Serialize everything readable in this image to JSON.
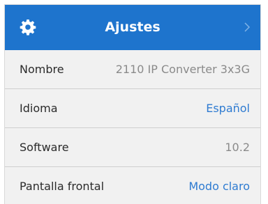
{
  "header": {
    "title": "Ajustes",
    "icon": "gear-icon",
    "chevron_icon": "chevron-right-icon",
    "background": "#1e74cd"
  },
  "rows": [
    {
      "label": "Nombre",
      "value": "2110 IP Converter 3x3G"
    },
    {
      "label": "Idioma",
      "value": "Español"
    },
    {
      "label": "Software",
      "value": "10.2"
    },
    {
      "label": "Pantalla frontal",
      "value": "Modo claro"
    }
  ]
}
